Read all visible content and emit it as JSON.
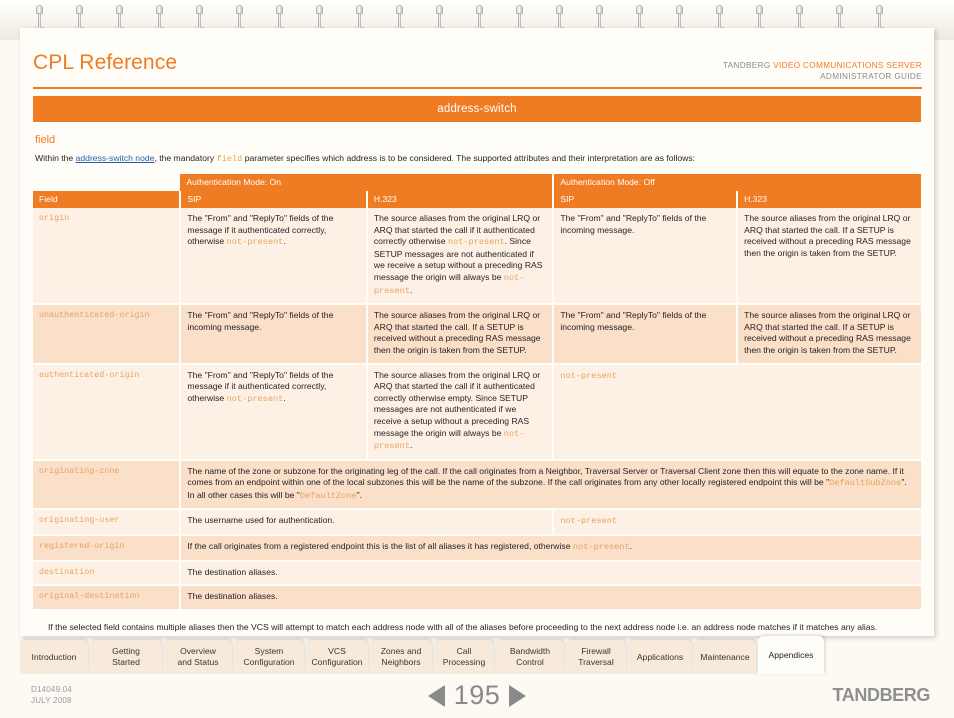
{
  "header": {
    "page_title": "CPL Reference",
    "vendor": "TANDBERG",
    "product": "VIDEO COMMUNICATIONS SERVER",
    "guide": "ADMINISTRATOR GUIDE"
  },
  "section_bar": {
    "title": "address-switch"
  },
  "field_section": {
    "heading": "field",
    "intro_pre": "Within the ",
    "intro_link": "address-switch node",
    "intro_mid": ", the mandatory ",
    "intro_code": "field",
    "intro_post": " parameter specifies which address is to be considered.  The supported attributes and their interpretation are as follows:"
  },
  "table": {
    "mode_on": "Authentication Mode: On",
    "mode_off": "Authentication Mode: Off",
    "columns": [
      "Field",
      "SIP",
      "H.323",
      "SIP",
      "H.323"
    ],
    "rows": [
      {
        "field": "origin",
        "on_sip_pre": "The \"From\" and \"ReplyTo\" fields of the message if it authenticated correctly, otherwise ",
        "on_sip_code": "not-present",
        "on_sip_post": ".",
        "on_h323_pre": "The source aliases from the original LRQ or ARQ that started the call if it authenticated correctly otherwise ",
        "on_h323_code": "not-present",
        "on_h323_mid": ". Since SETUP messages are not authenticated if we receive a setup without a preceding RAS message the origin will always be ",
        "on_h323_code2": "not-present",
        "on_h323_post": ".",
        "off_sip": "The \"From\" and \"ReplyTo\" fields of the incoming message.",
        "off_h323": "The source aliases from the original LRQ or ARQ that started the call. If a SETUP is received without a preceding RAS message then the origin is taken from the SETUP."
      },
      {
        "field": "unauthenticated-origin",
        "on_sip_pre": "The \"From\" and \"ReplyTo\" fields of the incoming message.",
        "on_h323_pre": "The source aliases from the original LRQ or ARQ that started the call. If a SETUP is received without a preceding RAS message then the origin is taken from the SETUP.",
        "off_sip": "The \"From\" and \"ReplyTo\" fields of the incoming message.",
        "off_h323": "The source aliases from the original LRQ or ARQ that started the call. If a SETUP is received without a preceding RAS message then the origin is taken from the SETUP."
      },
      {
        "field": "authenticated-origin",
        "on_sip_pre": "The \"From\" and \"ReplyTo\" fields of the message if it authenticated correctly, otherwise ",
        "on_sip_code": "not-present",
        "on_sip_post": ".",
        "on_h323_pre": "The source aliases from the original LRQ or ARQ that started the call if it authenticated correctly otherwise empty. Since SETUP messages are not authenticated if we receive a setup without a preceding RAS message the origin will always be ",
        "on_h323_code": "not-present",
        "on_h323_post": ".",
        "off_merged_code": "not-present"
      },
      {
        "field": "originating-zone",
        "merged_pre": "The name of the zone or subzone for the originating leg of the call. If the call originates from a Neighbor, Traversal Server or Traversal Client zone then this will equate to the zone name. If it comes from an endpoint within one of the local subzones this will be the name of the subzone. If the call originates from any other locally registered endpoint this will be \"",
        "merged_code": "DefaultSubZone",
        "merged_mid": "\". In all other cases this will be \"",
        "merged_code2": "DefaultZone",
        "merged_post": "\"."
      },
      {
        "field": "originating-user",
        "left_text": "The username used for authentication.",
        "right_code": "not-present"
      },
      {
        "field": "registered-origin",
        "merged_pre": "If the call originates from a registered endpoint this is the list of all aliases it has registered, otherwise ",
        "merged_code": "not-present",
        "merged_post": "."
      },
      {
        "field": "destination",
        "merged_pre": "The destination aliases."
      },
      {
        "field": "original-destination",
        "merged_pre": "The destination aliases."
      }
    ]
  },
  "closing_note": "If the selected field contains multiple aliases then the VCS will attempt to match each address node with all of the aliases before proceeding to the next address node i.e. an address node matches if it matches any alias.",
  "tabs": [
    {
      "label": "Introduction",
      "active": false
    },
    {
      "label": "Getting Started",
      "active": false
    },
    {
      "label": "Overview and Status",
      "active": false
    },
    {
      "label": "System Configuration",
      "active": false
    },
    {
      "label": "VCS Configuration",
      "active": false
    },
    {
      "label": "Zones and Neighbors",
      "active": false
    },
    {
      "label": "Call Processing",
      "active": false
    },
    {
      "label": "Bandwidth Control",
      "active": false
    },
    {
      "label": "Firewall Traversal",
      "active": false
    },
    {
      "label": "Applications",
      "active": false
    },
    {
      "label": "Maintenance",
      "active": false
    },
    {
      "label": "Appendices",
      "active": true
    }
  ],
  "footer": {
    "doc_number": "D14049.04",
    "doc_date": "JULY 2008",
    "page_number": "195",
    "brand": "TANDBERG"
  },
  "colors": {
    "accent_orange": "#ef7c22",
    "row_light": "#fdf1e6",
    "row_dark": "#fadfc9",
    "code_text": "#e8a35c",
    "link": "#2a5db0",
    "page_bg": "#fdfaf4"
  }
}
